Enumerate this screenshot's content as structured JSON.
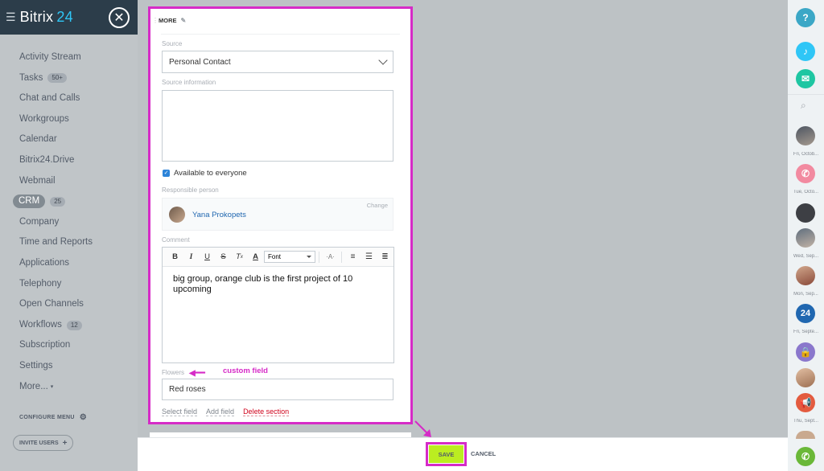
{
  "sidebar": {
    "brand_name": "Bitrix",
    "brand_number": "24",
    "items": [
      {
        "label": "Activity Stream"
      },
      {
        "label": "Tasks",
        "badge": "50+"
      },
      {
        "label": "Chat and Calls"
      },
      {
        "label": "Workgroups"
      },
      {
        "label": "Calendar"
      },
      {
        "label": "Bitrix24.Drive"
      },
      {
        "label": "Webmail"
      },
      {
        "label": "CRM",
        "badge": "25"
      },
      {
        "label": "Company"
      },
      {
        "label": "Time and Reports"
      },
      {
        "label": "Applications"
      },
      {
        "label": "Telephony"
      },
      {
        "label": "Open Channels"
      },
      {
        "label": "Workflows",
        "badge": "12"
      },
      {
        "label": "Subscription"
      },
      {
        "label": "Settings"
      },
      {
        "label": "More..."
      }
    ],
    "configure_label": "CONFIGURE MENU",
    "invite_label": "INVITE USERS"
  },
  "form": {
    "section_title": "MORE",
    "source_label": "Source",
    "source_value": "Personal Contact",
    "source_info_label": "Source information",
    "source_info_value": "",
    "available_label": "Available to everyone",
    "responsible_label": "Responsible person",
    "responsible_name": "Yana Prokopets",
    "change_label": "Change",
    "comment_label": "Comment",
    "font_select": "Font",
    "comment_text": "big group, orange club is the first project of 10 upcoming",
    "flowers_label": "Flowers",
    "flowers_value": "Red roses",
    "select_field": "Select field",
    "add_field": "Add field",
    "delete_section": "Delete section",
    "annotation": "custom field"
  },
  "footer": {
    "save_label": "SAVE",
    "cancel_label": "CANCEL"
  },
  "rightbar": {
    "dates": [
      "Fri, Octob...",
      "Tue, Octo...",
      "Wed, Sep...",
      "Mon, Sep...",
      "Fri, Septe...",
      "Thu, Sept..."
    ],
    "badge_24": "24"
  },
  "colors": {
    "accent_magenta": "#d62bc7",
    "save_green": "#bbed21",
    "header_dark": "#2c3d4a",
    "link_blue": "#2067b0"
  }
}
